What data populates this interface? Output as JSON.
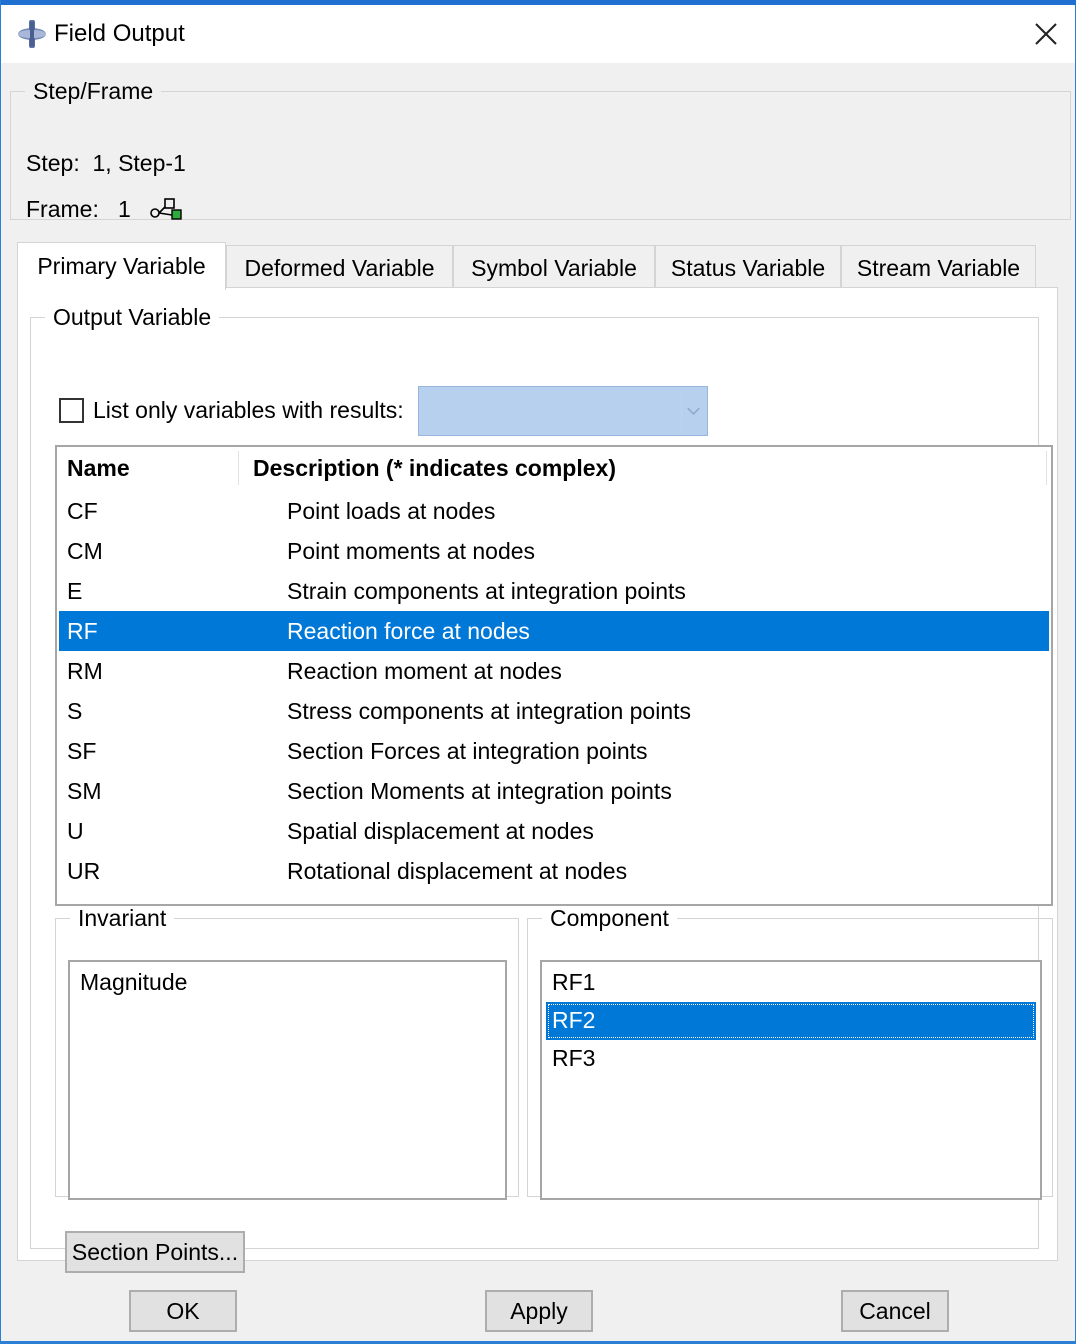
{
  "window": {
    "title": "Field Output",
    "title_icon": "abaqus-app-icon",
    "close_icon": "close-icon"
  },
  "step_frame": {
    "legend": "Step/Frame",
    "step_label": "Step:",
    "step_value": "1, Step-1",
    "frame_label": "Frame:",
    "frame_value": "1",
    "frame_icon": "frame-select-icon"
  },
  "tabs": [
    {
      "label": "Primary Variable",
      "active": true
    },
    {
      "label": "Deformed Variable",
      "active": false
    },
    {
      "label": "Symbol Variable",
      "active": false
    },
    {
      "label": "Status Variable",
      "active": false
    },
    {
      "label": "Stream Variable",
      "active": false
    }
  ],
  "output_variable": {
    "legend": "Output Variable",
    "list_only_label": "List only variables with results:",
    "list_only_checked": false,
    "results_select_value": "",
    "columns": {
      "name": "Name",
      "description": "Description (* indicates complex)"
    },
    "rows": [
      {
        "name": "CF",
        "description": "Point loads at nodes",
        "selected": false
      },
      {
        "name": "CM",
        "description": "Point moments at nodes",
        "selected": false
      },
      {
        "name": "E",
        "description": "Strain components at integration points",
        "selected": false
      },
      {
        "name": "RF",
        "description": "Reaction force at nodes",
        "selected": true
      },
      {
        "name": "RM",
        "description": "Reaction moment at nodes",
        "selected": false
      },
      {
        "name": "S",
        "description": "Stress components at integration points",
        "selected": false
      },
      {
        "name": "SF",
        "description": "Section Forces at integration points",
        "selected": false
      },
      {
        "name": "SM",
        "description": "Section Moments at integration points",
        "selected": false
      },
      {
        "name": "U",
        "description": "Spatial displacement at nodes",
        "selected": false
      },
      {
        "name": "UR",
        "description": "Rotational displacement at nodes",
        "selected": false
      }
    ]
  },
  "invariant": {
    "legend": "Invariant",
    "items": [
      {
        "label": "Magnitude",
        "selected": false
      }
    ]
  },
  "component": {
    "legend": "Component",
    "items": [
      {
        "label": "RF1",
        "selected": false
      },
      {
        "label": "RF2",
        "selected": true
      },
      {
        "label": "RF3",
        "selected": false
      }
    ]
  },
  "buttons": {
    "section_points": "Section Points...",
    "ok": "OK",
    "apply": "Apply",
    "cancel": "Cancel"
  },
  "colors": {
    "selection": "#0078d7",
    "title_strip": "#1f6fd0",
    "select_fill": "#b6d0ee"
  }
}
